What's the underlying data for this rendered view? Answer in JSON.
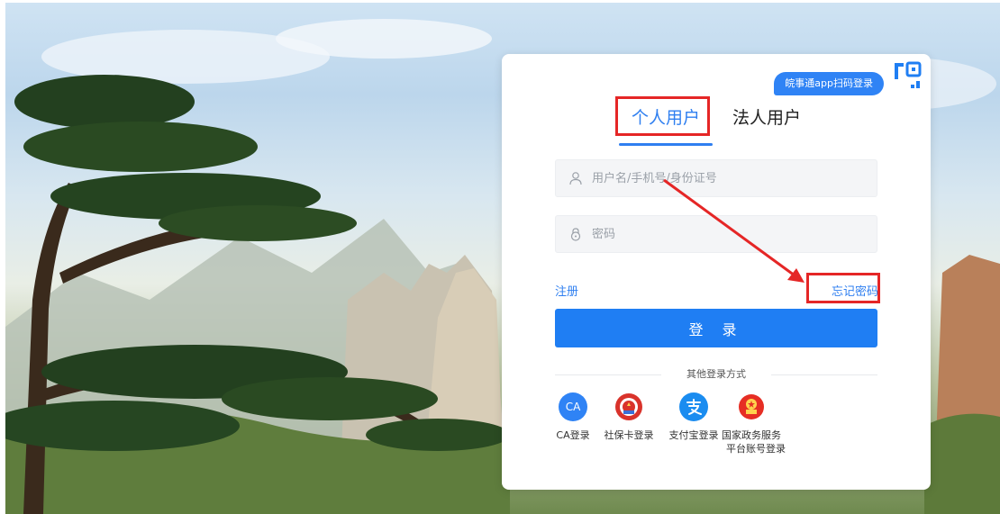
{
  "qr_badge": {
    "label": "皖事通app扫码登录"
  },
  "tabs": [
    {
      "label": "个人用户",
      "active": true
    },
    {
      "label": "法人用户",
      "active": false
    }
  ],
  "form": {
    "username_placeholder": "用户名/手机号/身份证号",
    "password_placeholder": "密码",
    "register_label": "注册",
    "forgot_label": "忘记密码",
    "login_label": "登 录"
  },
  "other_logins": {
    "title": "其他登录方式",
    "items": [
      {
        "icon": "CA",
        "label": "CA登录"
      },
      {
        "icon": "social-security-icon",
        "label": "社保卡登录"
      },
      {
        "icon": "alipay-icon",
        "label": "支付宝登录"
      },
      {
        "icon": "national-emblem-icon",
        "label_line1": "国家政务服务",
        "label_line2": "平台账号登录"
      }
    ]
  },
  "colors": {
    "primary": "#1f7ef3",
    "highlight": "#e52626",
    "ca": "#2f83f5",
    "social": "#d9332b",
    "alipay": "#1a8cf0",
    "emblem": "#e62e24"
  }
}
